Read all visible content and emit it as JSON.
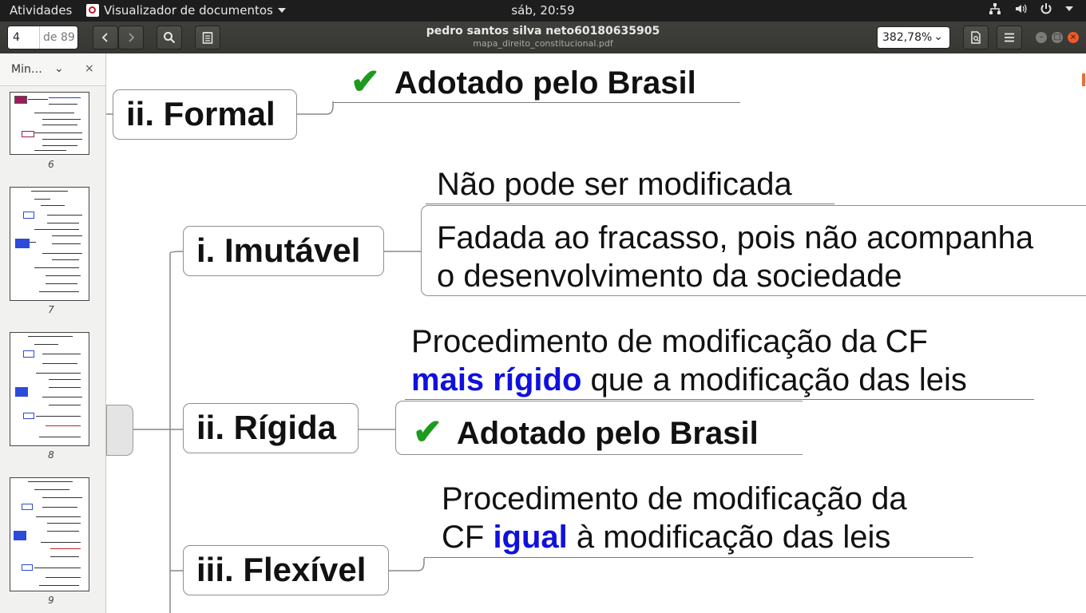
{
  "topbar": {
    "activities": "Atividades",
    "app_name": "Visualizador de documentos",
    "clock": "sáb, 20:59"
  },
  "header": {
    "page_current": "4",
    "page_total_label": "de 89",
    "title": "pedro santos silva neto60180635905",
    "subtitle": "mapa_direito_constitucional.pdf",
    "zoom": "382,78%"
  },
  "sidebar": {
    "mode_label": "Min…",
    "close_label": "×",
    "pages": [
      "6",
      "7",
      "8",
      "9"
    ]
  },
  "document": {
    "formal_node": "ii. Formal",
    "formal_leaf": "Adotado pelo Brasil",
    "imutavel_node": "i. Imutável",
    "imutavel_leaf1": "Não pode ser modificada",
    "imutavel_leaf2_line1": "Fadada ao fracasso, pois não acompanha",
    "imutavel_leaf2_line2": "o desenvolvimento da sociedade",
    "rigida_node": "ii. Rígida",
    "rigida_leaf1_line1": "Procedimento de modificação da CF",
    "rigida_leaf1_highlight": "mais rígido",
    "rigida_leaf1_rest": " que a modificação das leis",
    "rigida_leaf2": "Adotado pelo Brasil",
    "flexivel_node": "iii. Flexível",
    "flexivel_leaf_line1": "Procedimento de modificação da",
    "flexivel_leaf_pre": "CF ",
    "flexivel_leaf_highlight": "igual",
    "flexivel_leaf_rest": " à modificação das leis",
    "check_mark": "✔"
  },
  "colors": {
    "highlight_blue": "#1010dd",
    "check_green": "#1e9a1e",
    "topbar_bg": "#1d1d1d",
    "header_bg": "#3c3c39"
  }
}
